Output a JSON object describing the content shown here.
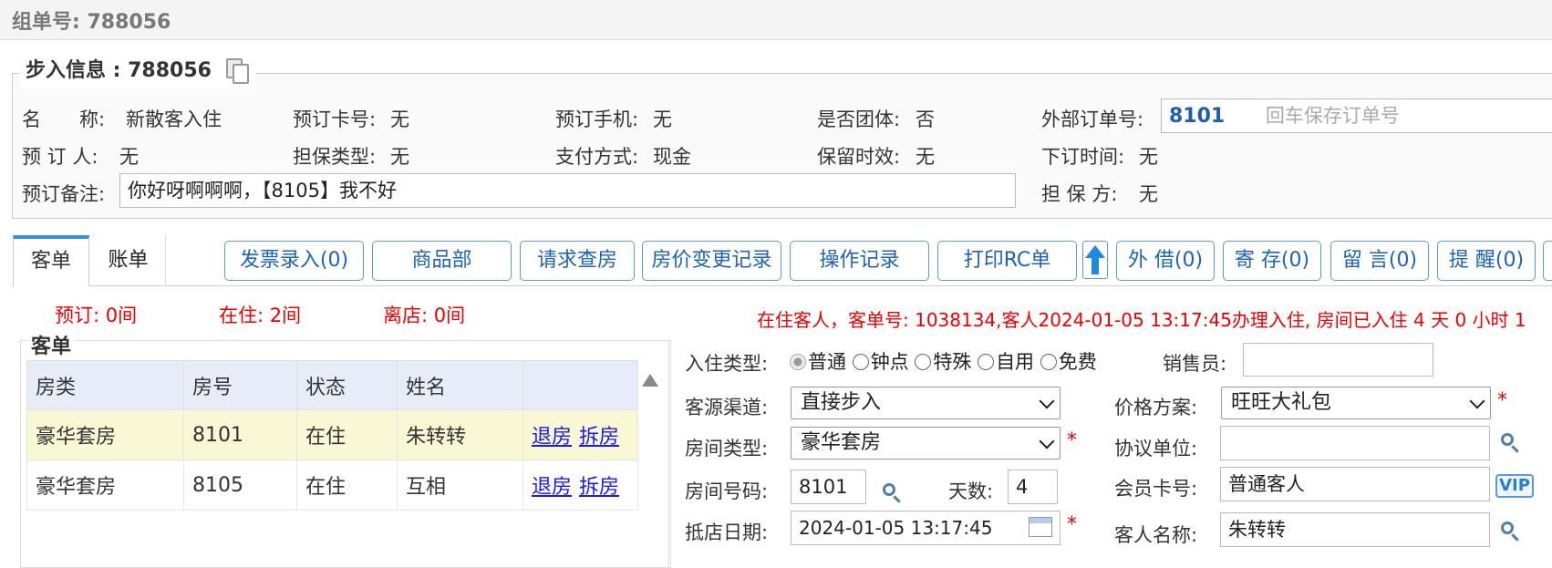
{
  "header": {
    "group_no": "组单号: 788056"
  },
  "walkin": {
    "title": "步入信息 : 788056",
    "name_label": "名　　称:",
    "name_value": "新散客入住",
    "card_label": "预订卡号:",
    "card_value": "无",
    "phone_label": "预订手机:",
    "phone_value": "无",
    "group_label": "是否团体:",
    "group_value": "否",
    "ext_order_label": "外部订单号:",
    "ext_order_value": "8101",
    "ext_order_placeholder": "回车保存订单号",
    "booker_label": "预 订 人:",
    "booker_value": "无",
    "guarantee_type_label": "担保类型:",
    "guarantee_type_value": "无",
    "pay_label": "支付方式:",
    "pay_value": "现金",
    "retain_label": "保留时效:",
    "retain_value": "无",
    "order_time_label": "下订时间:",
    "order_time_value": "无",
    "remark_label": "预订备注:",
    "remark_value": "你好呀啊啊啊，【8105】我不好",
    "guarantor_label": "担 保 方:",
    "guarantor_value": "无"
  },
  "tabs": [
    {
      "label": "客单"
    },
    {
      "label": "账单"
    }
  ],
  "toolbar": {
    "invoice": "发票录入(0)",
    "shop": "商品部",
    "check_room": "请求查房",
    "price_log": "房价变更记录",
    "op_log": "操作记录",
    "print_rc": "打印RC单",
    "lend": "外 借(0)",
    "deposit": "寄 存(0)",
    "message": "留 言(0)",
    "remind": "提 醒(0)"
  },
  "stats": {
    "booked": "预订: 0间",
    "staying": "在住: 2间",
    "left": "离店: 0间"
  },
  "notice": "在住客人，客单号: 1038134,客人2024-01-05 13:17:45办理入住, 房间已入住 4 天 0 小时 1",
  "guest_list": {
    "title": "客单",
    "columns": [
      "房类",
      "房号",
      "状态",
      "姓名",
      ""
    ],
    "rows": [
      {
        "type": "豪华套房",
        "room": "8101",
        "status": "在住",
        "name": "朱转转",
        "checkout": "退房",
        "split": "拆房"
      },
      {
        "type": "豪华套房",
        "room": "8105",
        "status": "在住",
        "name": "互相",
        "checkout": "退房",
        "split": "拆房"
      }
    ]
  },
  "form": {
    "checkin_type_label": "入住类型:",
    "checkin_types": [
      "普通",
      "钟点",
      "特殊",
      "自用",
      "免费"
    ],
    "sales_label": "销售员:",
    "sales_value": "",
    "source_label": "客源渠道:",
    "source_value": "直接步入",
    "price_plan_label": "价格方案:",
    "price_plan_value": "旺旺大礼包",
    "room_type_label": "房间类型:",
    "room_type_value": "豪华套房",
    "agreement_label": "协议单位:",
    "agreement_value": "",
    "room_no_label": "房间号码:",
    "room_no_value": "8101",
    "days_label": "天数:",
    "days_value": "4",
    "member_label": "会员卡号:",
    "member_value": "普通客人",
    "vip": "VIP",
    "arrival_label": "抵店日期:",
    "arrival_value": "2024-01-05 13:17:45",
    "guest_name_label": "客人名称:",
    "guest_name_value": "朱转转",
    "required_mark": "*"
  }
}
